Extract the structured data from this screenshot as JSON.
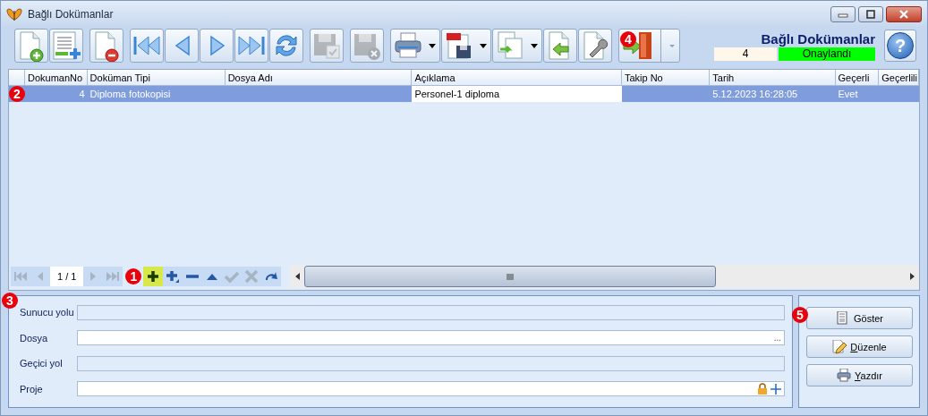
{
  "window": {
    "title": "Bağlı Dokümanlar"
  },
  "toolbar": {
    "items": [
      {
        "kind": "new",
        "disabled": false,
        "dropdown": false
      },
      {
        "kind": "add_lines",
        "disabled": false,
        "dropdown": false
      },
      {
        "kind": "delete",
        "disabled": false,
        "dropdown": false
      },
      {
        "kind": "first",
        "disabled": false,
        "dropdown": false
      },
      {
        "kind": "prev",
        "disabled": false,
        "dropdown": false
      },
      {
        "kind": "next",
        "disabled": false,
        "dropdown": false
      },
      {
        "kind": "last",
        "disabled": false,
        "dropdown": false
      },
      {
        "kind": "refresh",
        "disabled": false,
        "dropdown": false
      },
      {
        "kind": "save",
        "disabled": true,
        "dropdown": false
      },
      {
        "kind": "discard",
        "disabled": true,
        "dropdown": false
      },
      {
        "kind": "print",
        "disabled": false,
        "dropdown": true
      },
      {
        "kind": "pdf",
        "disabled": false,
        "dropdown": true
      },
      {
        "kind": "copy",
        "disabled": false,
        "dropdown": true
      },
      {
        "kind": "import",
        "disabled": false,
        "dropdown": false
      },
      {
        "kind": "tools",
        "disabled": false,
        "dropdown": false
      },
      {
        "kind": "exit",
        "disabled": false,
        "dropdown": true,
        "callout": "4"
      }
    ],
    "heading": "Bağlı Dokümanlar",
    "count": "4",
    "status": {
      "label": "Onaylandı",
      "color": "#00ff00"
    },
    "help": "?"
  },
  "grid": {
    "callout": "2",
    "columns": [
      "DokumanNo",
      "Doküman Tipi",
      "Dosya Adı",
      "Açıklama",
      "Takip No",
      "Tarih",
      "Geçerli",
      "Geçerlili"
    ],
    "rows": [
      {
        "selected": true,
        "cells": [
          {
            "text": "4",
            "focused": false
          },
          {
            "text": "Diploma fotokopisi",
            "focused": false
          },
          {
            "focused": false
          },
          {
            "text": "Personel-1 diploma",
            "focused": true
          },
          {
            "focused": false
          },
          {
            "text": "5.12.2023 16:28:05",
            "focused": false
          },
          {
            "text": "Evet",
            "focused": false
          },
          {
            "focused": false
          }
        ]
      }
    ]
  },
  "navigator": {
    "callout": "1",
    "position": "1 / 1",
    "items": [
      {
        "kind": "first",
        "disabled": true,
        "highlighted": false
      },
      {
        "kind": "prev",
        "disabled": true,
        "highlighted": false
      },
      {
        "kind": "position"
      },
      {
        "kind": "next",
        "disabled": true,
        "highlighted": false
      },
      {
        "kind": "last",
        "disabled": true,
        "highlighted": false
      },
      {
        "kind": "add",
        "disabled": false,
        "highlighted": true
      },
      {
        "kind": "add_child",
        "disabled": false,
        "highlighted": false
      },
      {
        "kind": "remove",
        "disabled": false,
        "highlighted": false
      },
      {
        "kind": "up",
        "disabled": false,
        "highlighted": false
      },
      {
        "kind": "confirm",
        "disabled": true,
        "highlighted": false
      },
      {
        "kind": "cancel",
        "disabled": true,
        "highlighted": false
      },
      {
        "kind": "redo",
        "disabled": false,
        "highlighted": false
      }
    ]
  },
  "form": {
    "callout": "3",
    "fields": [
      {
        "label": "Sunucu yolu",
        "kind": "text",
        "disabled": true
      },
      {
        "label": "Dosya",
        "kind": "browse",
        "disabled": false,
        "button": "..."
      },
      {
        "label": "Geçici yol",
        "kind": "text",
        "disabled": true
      },
      {
        "label": "Proje",
        "kind": "project",
        "disabled": false
      }
    ]
  },
  "actions": {
    "callout": "5",
    "buttons": [
      {
        "label": "Göster",
        "kind": "show",
        "mnemonic": false
      },
      {
        "label": "Düzenle",
        "kind": "edit",
        "mnemonic": true
      },
      {
        "label": "Yazdır",
        "kind": "print",
        "mnemonic": true
      }
    ]
  }
}
